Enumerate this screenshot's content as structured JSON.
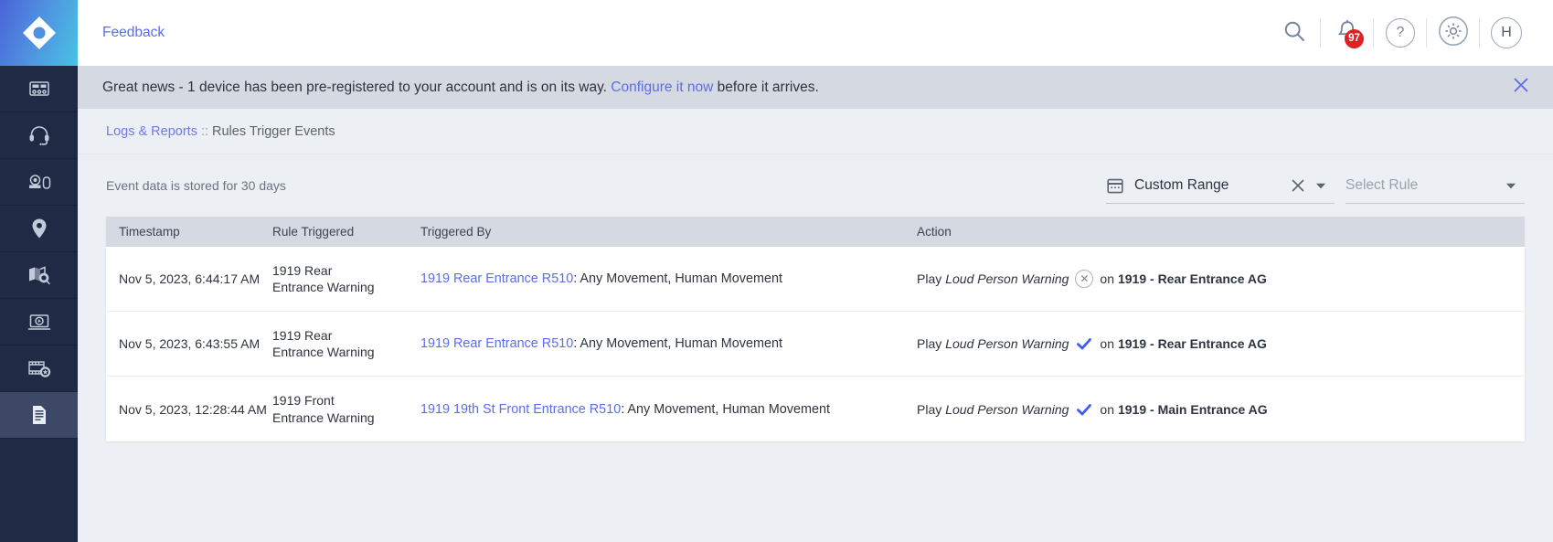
{
  "sidebar": {
    "logo_name": "app-logo",
    "items": [
      {
        "icon": "control-panel-icon",
        "label": "Dashboard",
        "active": false
      },
      {
        "icon": "headset-icon",
        "label": "Support",
        "active": false
      },
      {
        "icon": "camera-device-icon",
        "label": "Devices",
        "active": false
      },
      {
        "icon": "location-pin-icon",
        "label": "Locations",
        "active": false
      },
      {
        "icon": "map-search-icon",
        "label": "Map Search",
        "active": false
      },
      {
        "icon": "video-player-icon",
        "label": "Live View",
        "active": false
      },
      {
        "icon": "film-star-icon",
        "label": "Clips",
        "active": false
      },
      {
        "icon": "document-icon",
        "label": "Logs & Reports",
        "active": true
      }
    ]
  },
  "topbar": {
    "feedback_label": "Feedback",
    "search_icon": "search-icon",
    "bell_icon": "bell-icon",
    "bell_badge": "97",
    "help_icon": "help-icon",
    "help_glyph": "?",
    "settings_icon": "gear-icon",
    "avatar_initial": "H"
  },
  "banner": {
    "text_before": "Great news - 1 device has been pre-registered to your account and is on its way. ",
    "link_label": "Configure it now",
    "text_after": " before it arrives.",
    "close_icon": "close-icon",
    "close_glyph": "✕"
  },
  "breadcrumb": {
    "link_label": "Logs & Reports",
    "separator": "::",
    "current_label": "Rules Trigger Events"
  },
  "filters": {
    "retention_note": "Event data is stored for 30 days",
    "date_range": {
      "icon": "calendar-icon",
      "value": "Custom Range",
      "clear_glyph": "✕",
      "caret_glyph": "▼"
    },
    "rule_select": {
      "placeholder": "Select Rule",
      "caret_glyph": "▼"
    }
  },
  "table": {
    "columns": [
      "Timestamp",
      "Rule Triggered",
      "Triggered By",
      "Action"
    ],
    "rows": [
      {
        "timestamp": "Nov 5, 2023, 6:44:17 AM",
        "rule_triggered": "1919 Rear Entrance Warning",
        "triggered_by_device": "1919 Rear Entrance R510",
        "triggered_by_detail": ": Any Movement, Human Movement",
        "action_verb": "Play",
        "action_sound": "Loud Person Warning",
        "action_status": "failed",
        "action_status_icon": "failed-circle-x-icon",
        "action_status_glyph": "✕",
        "action_on": "on",
        "action_target": "1919 - Rear Entrance AG"
      },
      {
        "timestamp": "Nov 5, 2023, 6:43:55 AM",
        "rule_triggered": "1919 Rear Entrance Warning",
        "triggered_by_device": "1919 Rear Entrance R510",
        "triggered_by_detail": ": Any Movement, Human Movement",
        "action_verb": "Play",
        "action_sound": "Loud Person Warning",
        "action_status": "success",
        "action_status_icon": "success-check-icon",
        "action_status_glyph": "✔",
        "action_on": "on",
        "action_target": "1919 - Rear Entrance AG"
      },
      {
        "timestamp": "Nov 5, 2023, 12:28:44 AM",
        "rule_triggered": "1919 Front Entrance Warning",
        "triggered_by_device": "1919 19th St Front Entrance R510",
        "triggered_by_detail": ": Any Movement, Human Movement",
        "action_verb": "Play",
        "action_sound": "Loud Person Warning",
        "action_status": "success",
        "action_status_icon": "success-check-icon",
        "action_status_glyph": "✔",
        "action_on": "on",
        "action_target": "1919 - Main Entrance AG"
      }
    ]
  },
  "colors": {
    "sidebar_bg": "#1f2a44",
    "sidebar_active": "#3c4866",
    "accent_link": "#5b6ee8",
    "banner_bg": "#d5d9e2",
    "page_bg": "#eceff3",
    "badge_red": "#df2222",
    "success_check": "#3d5afe",
    "table_header_bg": "#d5d9e2"
  }
}
